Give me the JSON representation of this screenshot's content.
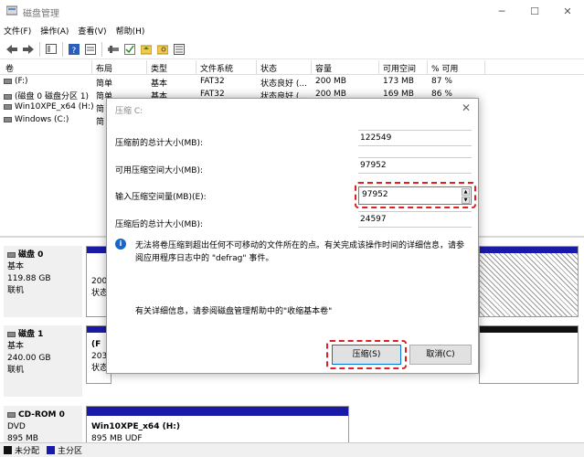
{
  "window": {
    "title": "磁盘管理"
  },
  "menu": [
    "文件(F)",
    "操作(A)",
    "查看(V)",
    "帮助(H)"
  ],
  "volume_table": {
    "headers": [
      "卷",
      "布局",
      "类型",
      "文件系统",
      "状态",
      "容量",
      "可用空间",
      "% 可用"
    ],
    "rows": [
      [
        "(F:)",
        "简单",
        "基本",
        "FAT32",
        "状态良好 (...",
        "200 MB",
        "173 MB",
        "87 %"
      ],
      [
        "(磁盘 0 磁盘分区 1)",
        "简单",
        "基本",
        "FAT32",
        "状态良好 (...",
        "200 MB",
        "169 MB",
        "86 %"
      ],
      [
        "Win10XPE_x64 (H:)",
        "简",
        "",
        "",
        "",
        "",
        "",
        ""
      ],
      [
        "Windows (C:)",
        "简",
        "",
        "",
        "",
        "",
        "",
        ""
      ]
    ]
  },
  "disks": [
    {
      "name": "磁盘 0",
      "type": "基本",
      "size": "119.88 GB",
      "status": "联机",
      "part_line1": "200",
      "part_line2": "状态"
    },
    {
      "name": "磁盘 1",
      "type": "基本",
      "size": "240.00 GB",
      "status": "联机",
      "part_line0": "(F",
      "part_line1": "203",
      "part_line2": "状态"
    },
    {
      "name": "CD-ROM 0",
      "type": "DVD",
      "size": "895 MB",
      "status": "联机",
      "part_name": "Win10XPE_x64  (H:)",
      "part_line1": "895 MB UDF"
    }
  ],
  "legend": {
    "unallocated": "未分配",
    "primary": "主分区"
  },
  "dialog": {
    "title": "压缩 C:",
    "total_before_label": "压缩前的总计大小(MB):",
    "total_before_value": "122549",
    "available_label": "可用压缩空间大小(MB):",
    "available_value": "97952",
    "amount_label": "输入压缩空间量(MB)(E):",
    "amount_value": "97952",
    "total_after_label": "压缩后的总计大小(MB):",
    "total_after_value": "24597",
    "info_text": "无法将卷压缩到超出任何不可移动的文件所在的点。有关完成该操作时间的详细信息，请参阅应用程序日志中的 \"defrag\" 事件。",
    "help_text": "有关详细信息，请参阅磁盘管理帮助中的\"收缩基本卷\"",
    "ok_label": "压缩(S)",
    "cancel_label": "取消(C)"
  },
  "colors": {
    "primary_partition": "#1a1aa8",
    "unallocated": "#111111",
    "highlight": "#e02020"
  }
}
